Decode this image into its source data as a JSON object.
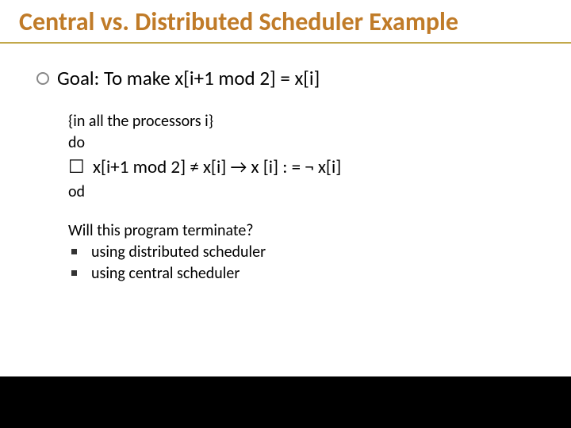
{
  "title": "Central vs. Distributed Scheduler Example",
  "goal": "Goal: To make x[i+1 mod 2] = x[i]",
  "code": {
    "line1": "{in all the processors i}",
    "line2": "do",
    "line3": "☐  x[i+1 mod 2] ≠ x[i] → x [i] : = ¬ x[i]",
    "line4": "od"
  },
  "question": "Will this program terminate?",
  "opts": {
    "a": "using distributed scheduler",
    "b": "using central scheduler"
  }
}
